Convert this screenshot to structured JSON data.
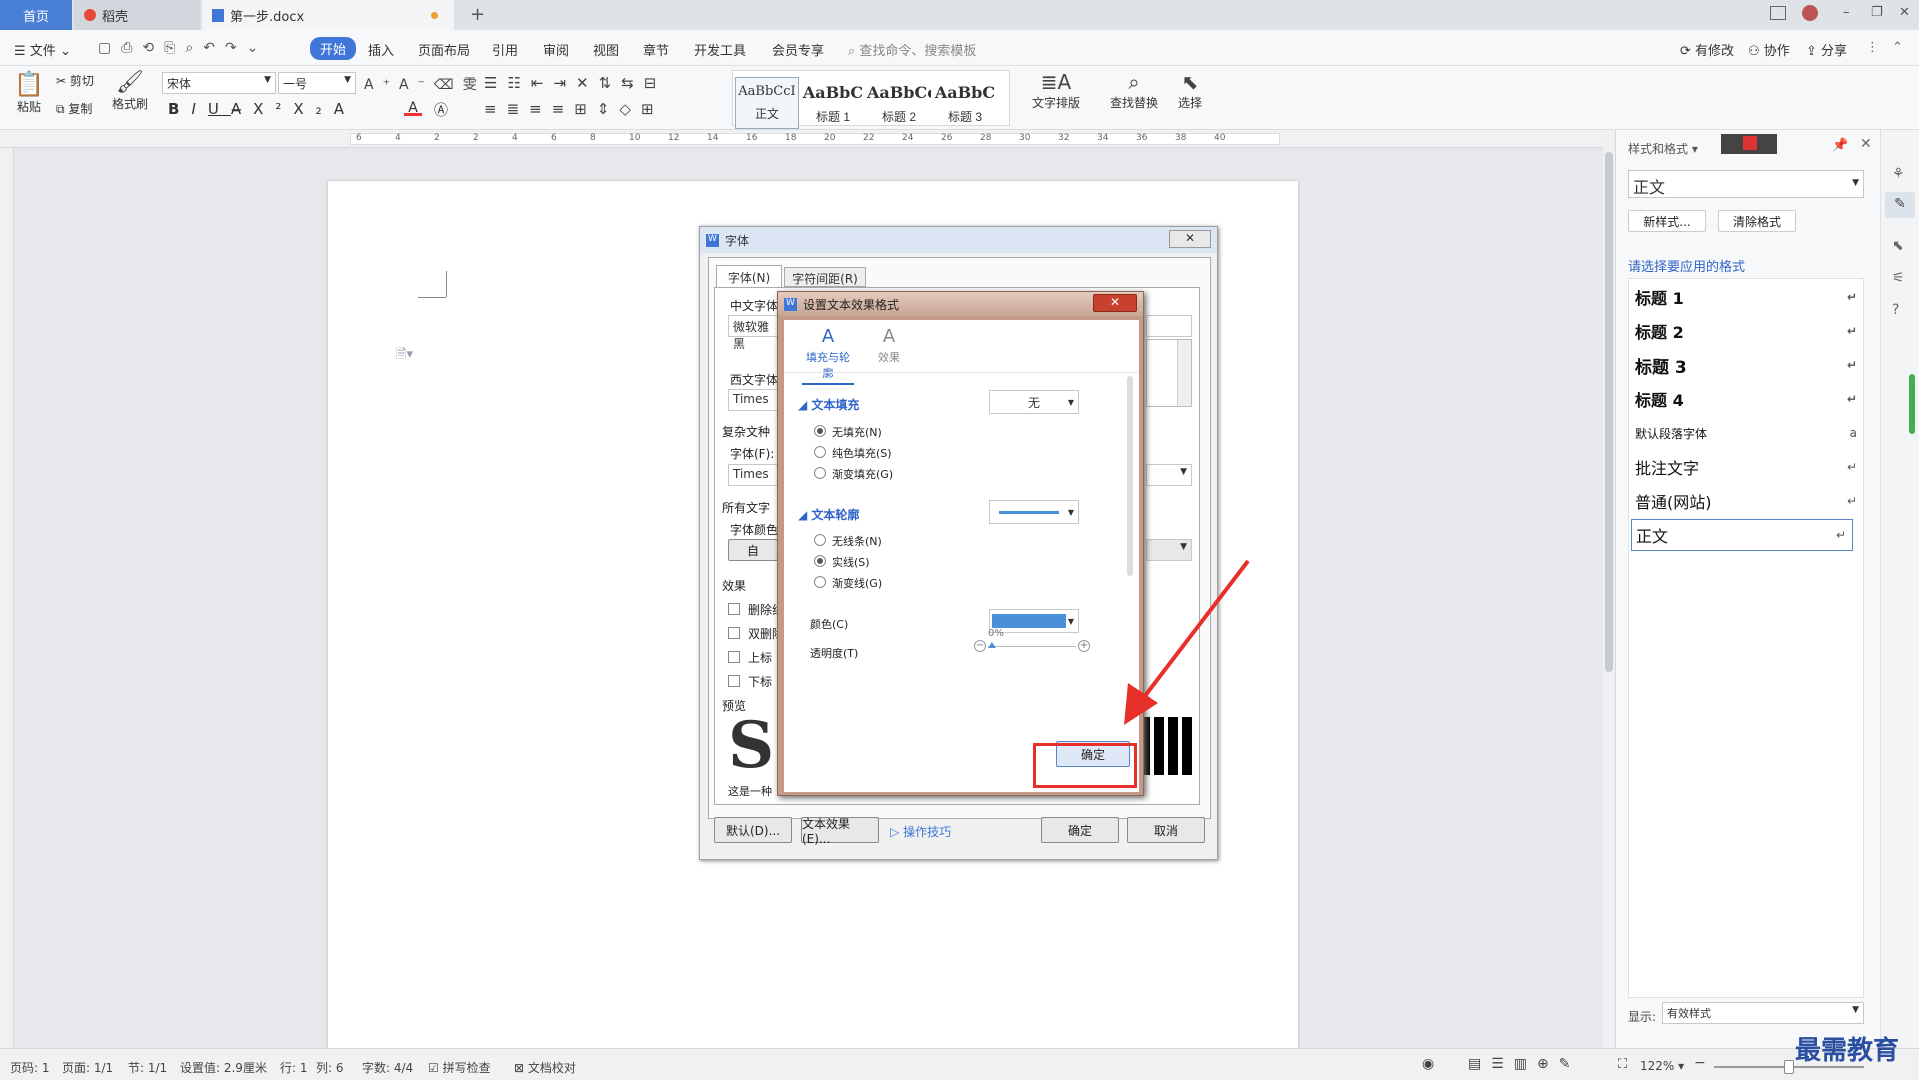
{
  "tabs": {
    "home": "首页",
    "daoke": "稻壳",
    "doc": "第一步.docx",
    "new_tab": "+"
  },
  "titlebar": {
    "minimize": "–",
    "restore": "❐",
    "close": "✕"
  },
  "menu": {
    "file": "文件",
    "items": [
      "开始",
      "插入",
      "页面布局",
      "引用",
      "审阅",
      "视图",
      "章节",
      "开发工具",
      "会员专享"
    ],
    "search": "查找命令、搜索模板",
    "right": [
      "有修改",
      "协作",
      "分享"
    ]
  },
  "ribbon": {
    "paste": "粘贴",
    "cut": "剪切",
    "copy": "复制",
    "format_painter": "格式刷",
    "font_name": "宋体",
    "font_size": "一号",
    "styles": [
      {
        "sample": "AaBbCcI",
        "label": "正文"
      },
      {
        "sample": "AaBbC",
        "label": "标题 1"
      },
      {
        "sample": "AaBbCc",
        "label": "标题 2"
      },
      {
        "sample": "AaBbC",
        "label": "标题 3"
      }
    ],
    "text_layout": "文字排版",
    "find_replace": "查找替换",
    "select": "选择"
  },
  "ruler_marks": [
    "6",
    "4",
    "2",
    "2",
    "4",
    "6",
    "8",
    "10",
    "12",
    "14",
    "16",
    "18",
    "20",
    "22",
    "24",
    "26",
    "28",
    "30",
    "32",
    "34",
    "36",
    "38",
    "40"
  ],
  "font_dialog": {
    "title": "字体",
    "tab_font": "字体(N)",
    "tab_spacing": "字符间距(R)",
    "chinese_font_label": "中文字体",
    "chinese_font_value": "微软雅黑",
    "western_font_label": "西文字体",
    "western_font_value": "Times",
    "complex_label": "复杂文种",
    "complex_font_label": "字体(F):",
    "complex_font_value": "Times",
    "all_text_label": "所有文字",
    "font_color_label": "字体颜色",
    "font_color_value": "自",
    "effects_label": "效果",
    "effects": [
      "删除线",
      "双删除",
      "上标",
      "下标"
    ],
    "preview_label": "预览",
    "preview_note": "这是一种",
    "btn_default": "默认(D)...",
    "btn_text_effect": "文本效果(E)...",
    "tips": "操作技巧",
    "btn_ok": "确定",
    "btn_cancel": "取消"
  },
  "effect_dialog": {
    "title": "设置文本效果格式",
    "tab_fill": "填充与轮廓",
    "tab_effect": "效果",
    "text_fill": "文本填充",
    "fill_value": "无",
    "fill_options": [
      "无填充(N)",
      "纯色填充(S)",
      "渐变填充(G)"
    ],
    "text_outline": "文本轮廓",
    "outline_options": [
      "无线条(N)",
      "实线(S)",
      "渐变线(G)"
    ],
    "color_label": "颜色(C)",
    "color_value": "#4a90d9",
    "transparency_label": "透明度(T)",
    "transparency_value": "0%",
    "ok": "确定"
  },
  "right_panel": {
    "title": "样式和格式",
    "current": "正文",
    "new_style": "新样式...",
    "clear_format": "清除格式",
    "prompt": "请选择要应用的格式",
    "styles": [
      {
        "name": "标题  1",
        "bold": true
      },
      {
        "name": "标题  2",
        "bold": true
      },
      {
        "name": "标题  3",
        "bold": true
      },
      {
        "name": "标题  4",
        "bold": true
      },
      {
        "name": "默认段落字体",
        "bold": false,
        "small": true
      },
      {
        "name": "批注文字",
        "bold": false
      },
      {
        "name": "普通(网站)",
        "bold": false
      },
      {
        "name": "正文",
        "bold": false,
        "selected": true
      }
    ],
    "show_label": "显示:",
    "show_value": "有效样式"
  },
  "statusbar": {
    "page_code": "页码: 1",
    "page": "页面: 1/1",
    "section": "节: 1/1",
    "setting": "设置值: 2.9厘米",
    "row": "行: 1",
    "col": "列: 6",
    "words": "字数: 4/4",
    "spell": "拼写检查",
    "proof": "文档校对",
    "zoom": "122%"
  },
  "watermark": "最需教育",
  "colors": {
    "accent": "#3f76d8",
    "highlight": "#e8302a"
  }
}
